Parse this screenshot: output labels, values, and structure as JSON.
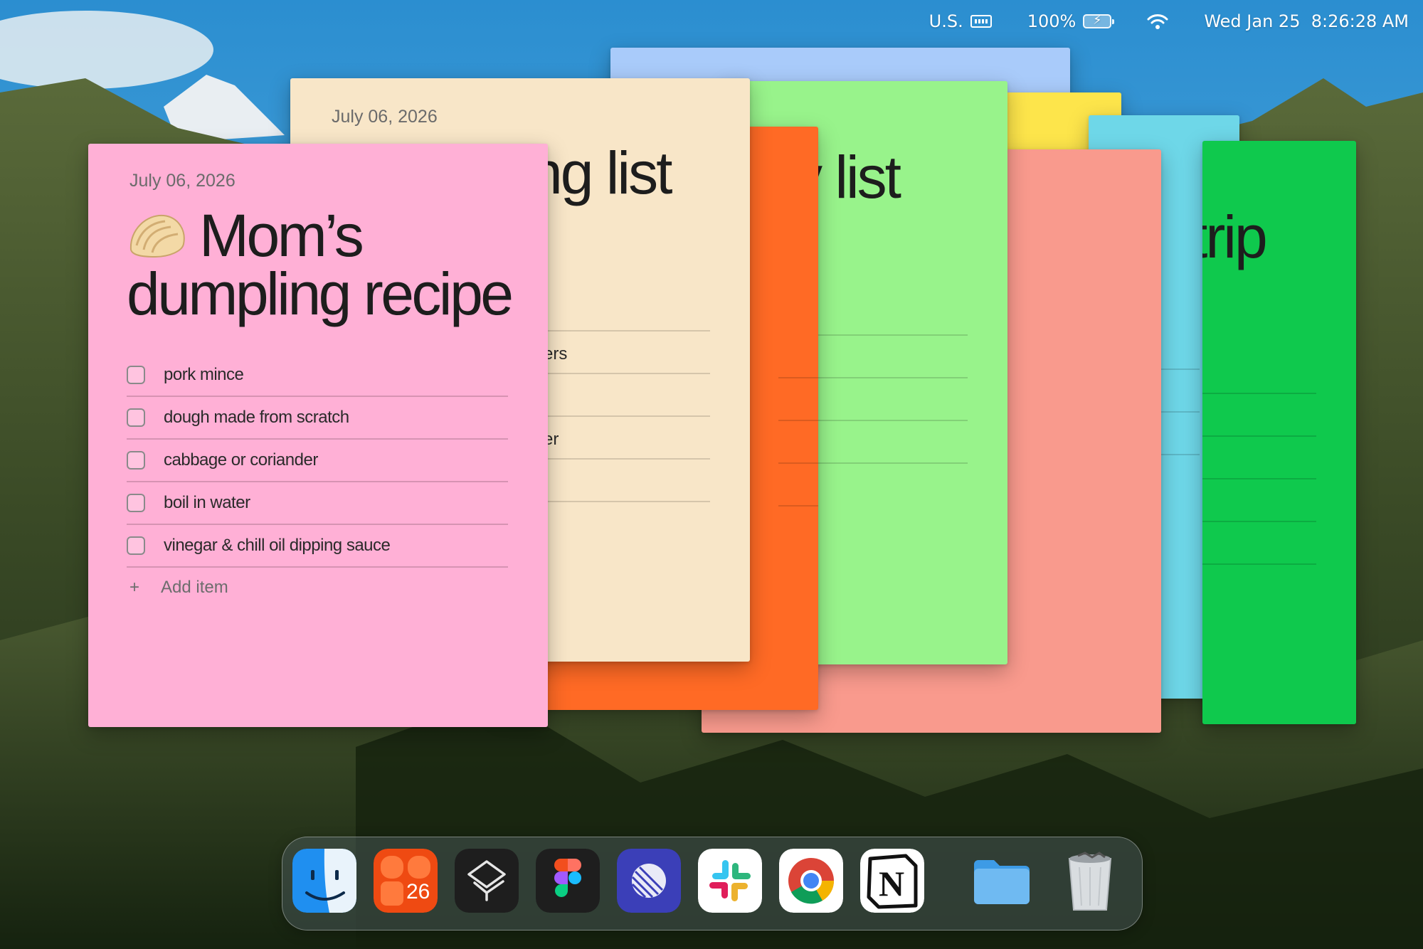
{
  "menubar": {
    "keyboard_layout": "U.S.",
    "battery_percent": "100%",
    "datetime": "Wed Jan 25  8:26:28 AM"
  },
  "notes": {
    "pink": {
      "date": "July 06, 2026",
      "title_line1": "Mom’s",
      "title_line2": "dumpling recipe",
      "items": [
        "pork mince",
        "dough made from scratch",
        "cabbage or coriander",
        "boil in water",
        "vinegar & chill oil dipping sauce"
      ],
      "add_item_label": "Add item",
      "color": "#ffb0d6"
    },
    "cream": {
      "date": "July 06, 2026",
      "title_fragment": "ng list",
      "item_fragments": [
        "ers",
        "er"
      ],
      "color": "#f8e6c8"
    },
    "light_green": {
      "title_fragment": "y list",
      "color": "#98f38b"
    },
    "green": {
      "title_fragment": "trip",
      "color": "#0fc94d"
    },
    "blue": {
      "color": "#a9cbfa"
    },
    "yellow": {
      "color": "#fde54b"
    },
    "cyan": {
      "color": "#6ed7e8"
    },
    "orange": {
      "color": "#ff6a25"
    },
    "salmon": {
      "color": "#f99a8d"
    }
  },
  "dock": {
    "apps": [
      {
        "name": "Finder",
        "icon": "finder-icon"
      },
      {
        "name": "Fantastical",
        "icon": "calendar-icon",
        "badge_text": "26"
      },
      {
        "name": "Craft",
        "icon": "layers-icon"
      },
      {
        "name": "Figma",
        "icon": "figma-icon"
      },
      {
        "name": "Linear",
        "icon": "linear-icon"
      },
      {
        "name": "Slack",
        "icon": "slack-icon"
      },
      {
        "name": "Chrome",
        "icon": "chrome-icon"
      },
      {
        "name": "Notion",
        "icon": "notion-icon",
        "letter": "N"
      },
      {
        "name": "Folder",
        "icon": "folder-icon"
      },
      {
        "name": "Trash",
        "icon": "trash-icon"
      }
    ]
  }
}
